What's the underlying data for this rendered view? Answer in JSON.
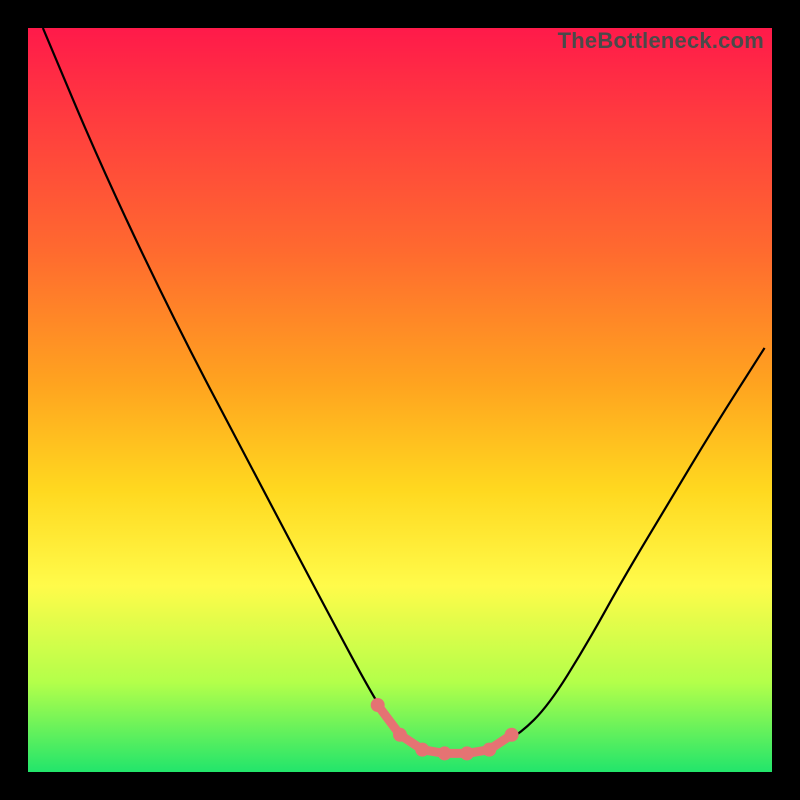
{
  "watermark": "TheBottleneck.com",
  "chart_data": {
    "type": "line",
    "title": "",
    "xlabel": "",
    "ylabel": "",
    "xlim": [
      0,
      100
    ],
    "ylim": [
      0,
      100
    ],
    "legend": false,
    "grid": false,
    "background": "rainbow-vertical-gradient",
    "series": [
      {
        "name": "curve",
        "stroke": "#000000",
        "x": [
          2,
          10,
          20,
          30,
          40,
          47,
          50,
          53,
          56,
          59,
          62,
          66,
          70,
          75,
          80,
          86,
          92,
          99
        ],
        "values": [
          100,
          81,
          60,
          41,
          22,
          9,
          5,
          3,
          2.5,
          2.5,
          3,
          5,
          9,
          17,
          26,
          36,
          46,
          57
        ]
      }
    ],
    "markers": {
      "comment": "salmon dots and thick bottom segment highlighting the curve minimum",
      "color": "#e57373",
      "points_x": [
        47,
        50,
        53,
        56,
        59,
        62,
        65
      ],
      "points_y": [
        9,
        5,
        3,
        2.5,
        2.5,
        3,
        5
      ]
    }
  }
}
